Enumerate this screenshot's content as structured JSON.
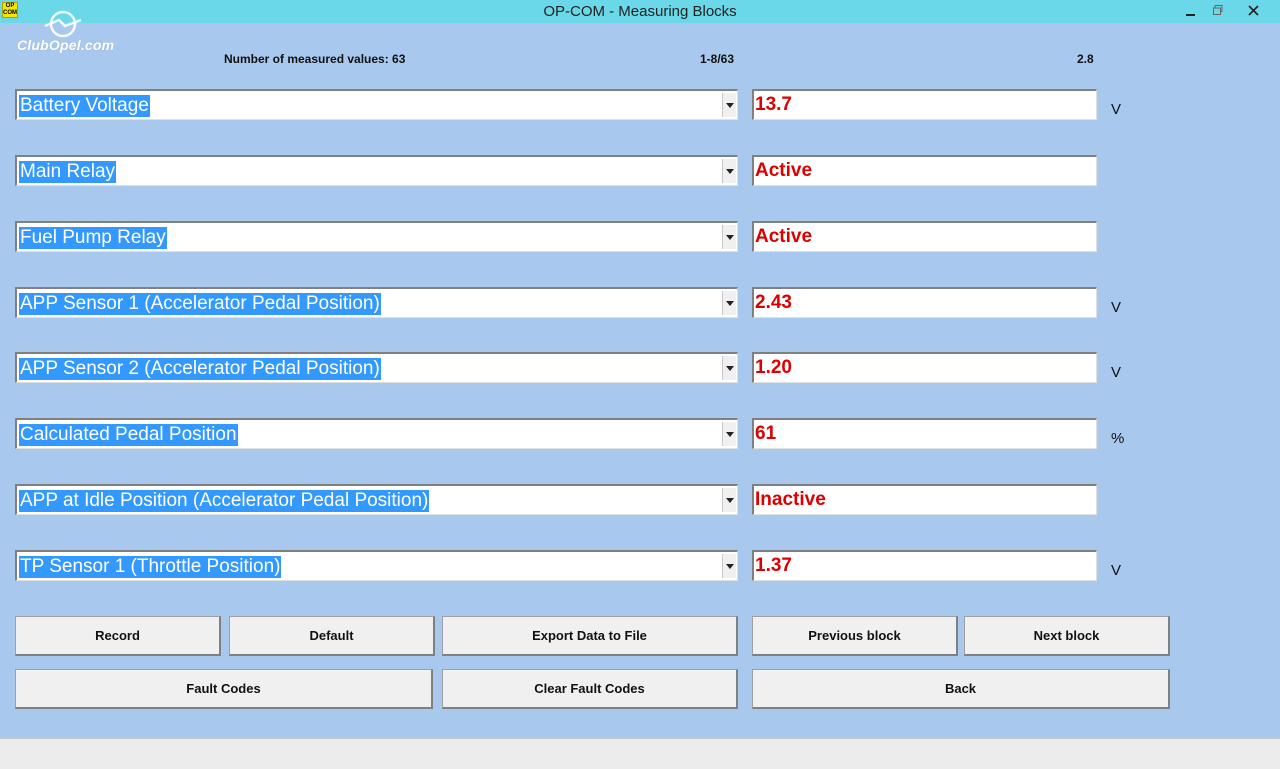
{
  "window": {
    "title": "OP-COM - Measuring Blocks",
    "app_icon_text": "OP COM",
    "minimize_glyph": "🗕",
    "maximize_glyph": "🗗",
    "close_glyph": "✕"
  },
  "logo": {
    "text": "ClubOpel.com"
  },
  "info": {
    "measured_count": "Number of measured values: 63",
    "range": "1-8/63",
    "version": "2.8"
  },
  "rows": [
    {
      "label": "Battery Voltage",
      "value": "13.7",
      "unit": "V"
    },
    {
      "label": "Main Relay",
      "value": "Active",
      "unit": ""
    },
    {
      "label": "Fuel Pump Relay",
      "value": "Active",
      "unit": ""
    },
    {
      "label": "APP Sensor 1 (Accelerator Pedal Position)",
      "value": "2.43",
      "unit": "V"
    },
    {
      "label": "APP Sensor 2 (Accelerator Pedal Position)",
      "value": "1.20",
      "unit": "V"
    },
    {
      "label": "Calculated Pedal Position",
      "value": "61",
      "unit": "%"
    },
    {
      "label": "APP at Idle Position (Accelerator Pedal Position)",
      "value": "Inactive",
      "unit": ""
    },
    {
      "label": "TP Sensor 1 (Throttle Position)",
      "value": "1.37",
      "unit": "V"
    }
  ],
  "buttons": {
    "record": "Record",
    "default": "Default",
    "export": "Export Data to File",
    "previous": "Previous block",
    "next": "Next block",
    "fault_codes": "Fault Codes",
    "clear_fault_codes": "Clear Fault Codes",
    "back": "Back"
  },
  "colors": {
    "background": "#a8c8ee",
    "titlebar": "#6ad8e8",
    "value_text": "#dd0000",
    "selection": "#3399ff"
  }
}
